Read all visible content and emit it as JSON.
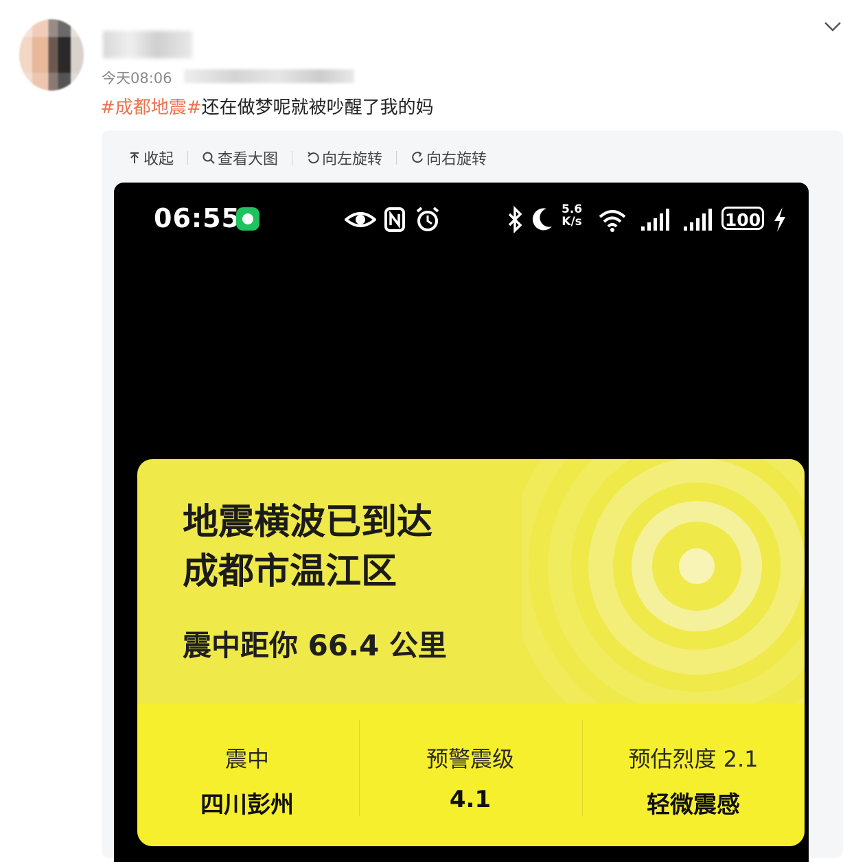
{
  "post": {
    "time": "今天08:06",
    "hashtag": "#成都地震#",
    "text": "还在做梦呢就被吵醒了我的妈"
  },
  "toolbar": {
    "collapse": "收起",
    "view_large": "查看大图",
    "rotate_left": "向左旋转",
    "rotate_right": "向右旋转"
  },
  "screenshot": {
    "status_time": "06:55",
    "net_speed_value": "5.6",
    "net_speed_unit": "K/s",
    "battery": "100",
    "alert": {
      "line1": "地震横波已到达",
      "line2": "成都市温江区",
      "distance": "震中距你 66.4 公里",
      "epicenter_label": "震中",
      "epicenter_value": "四川彭州",
      "magnitude_label": "预警震级",
      "magnitude_value": "4.1",
      "intensity_label": "预估烈度 2.1",
      "intensity_value": "轻微震感"
    },
    "colors": {
      "alert_top": "#efe94a",
      "alert_bottom": "#f6ef2d"
    }
  }
}
